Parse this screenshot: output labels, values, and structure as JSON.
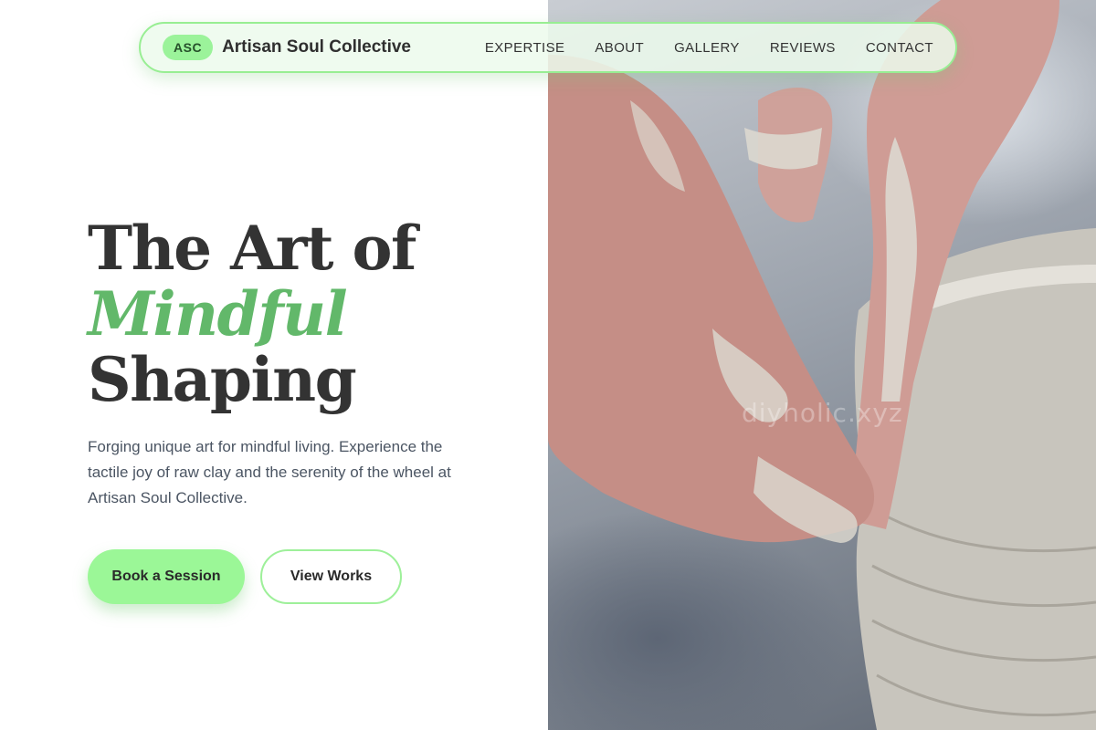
{
  "nav": {
    "badge": "ASC",
    "brand_name": "Artisan Soul Collective",
    "links": [
      "EXPERTISE",
      "ABOUT",
      "GALLERY",
      "REVIEWS",
      "CONTACT"
    ]
  },
  "hero": {
    "title_line1": "The Art of",
    "title_accent": "Mindful",
    "title_line3": "Shaping",
    "description": "Forging unique art for mindful living. Experience the tactile joy of raw clay and the serenity of the wheel at Artisan Soul Collective.",
    "primary_button": "Book a Session",
    "secondary_button": "View Works"
  },
  "photo": {
    "subject": "hands shaping clay on a pottery wheel",
    "watermark": "diyholic.xyz"
  },
  "colors": {
    "accent": "#62b86a",
    "button_green": "#9bf797",
    "nav_border": "#98ee93",
    "title": "#333333",
    "body_text": "#4b5563"
  }
}
